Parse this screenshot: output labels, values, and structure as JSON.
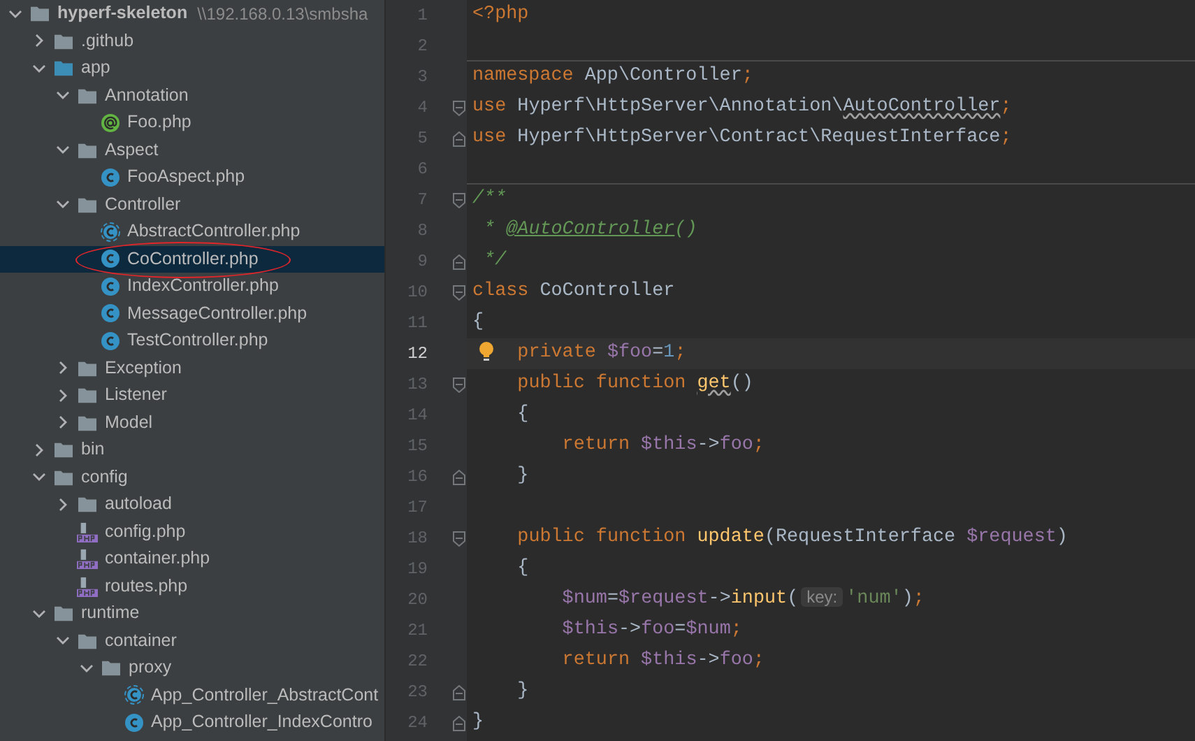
{
  "project_tree": [
    {
      "name": "hyperf-skeleton",
      "path": "\\\\192.168.0.13\\smbsha",
      "kind": "folder",
      "expanded": true,
      "selected": false,
      "children": [
        {
          "name": ".github",
          "kind": "folder",
          "expanded": false,
          "selected": false
        },
        {
          "name": "app",
          "kind": "source-folder",
          "expanded": true,
          "selected": false,
          "children": [
            {
              "name": "Annotation",
              "kind": "folder",
              "expanded": true,
              "selected": false,
              "children": [
                {
                  "name": "Foo.php",
                  "kind": "annotation",
                  "selected": false
                }
              ]
            },
            {
              "name": "Aspect",
              "kind": "folder",
              "expanded": true,
              "selected": false,
              "children": [
                {
                  "name": "FooAspect.php",
                  "kind": "class",
                  "selected": false
                }
              ]
            },
            {
              "name": "Controller",
              "kind": "folder",
              "expanded": true,
              "selected": false,
              "children": [
                {
                  "name": "AbstractController.php",
                  "kind": "abstract-class",
                  "selected": false
                },
                {
                  "name": "CoController.php",
                  "kind": "class",
                  "selected": true,
                  "circled": true
                },
                {
                  "name": "IndexController.php",
                  "kind": "class",
                  "selected": false
                },
                {
                  "name": "MessageController.php",
                  "kind": "class",
                  "selected": false
                },
                {
                  "name": "TestController.php",
                  "kind": "class",
                  "selected": false
                }
              ]
            },
            {
              "name": "Exception",
              "kind": "folder",
              "expanded": false,
              "selected": false
            },
            {
              "name": "Listener",
              "kind": "folder",
              "expanded": false,
              "selected": false
            },
            {
              "name": "Model",
              "kind": "folder",
              "expanded": false,
              "selected": false
            }
          ]
        },
        {
          "name": "bin",
          "kind": "folder",
          "expanded": false,
          "selected": false
        },
        {
          "name": "config",
          "kind": "folder",
          "expanded": true,
          "selected": false,
          "children": [
            {
              "name": "autoload",
              "kind": "folder",
              "expanded": false,
              "selected": false
            },
            {
              "name": "config.php",
              "kind": "php-file",
              "selected": false
            },
            {
              "name": "container.php",
              "kind": "php-file",
              "selected": false
            },
            {
              "name": "routes.php",
              "kind": "php-file",
              "selected": false
            }
          ]
        },
        {
          "name": "runtime",
          "kind": "folder",
          "expanded": true,
          "selected": false,
          "children": [
            {
              "name": "container",
              "kind": "folder",
              "expanded": true,
              "selected": false,
              "children": [
                {
                  "name": "proxy",
                  "kind": "folder",
                  "expanded": true,
                  "selected": false,
                  "children": [
                    {
                      "name": "App_Controller_AbstractCont",
                      "kind": "abstract-class",
                      "selected": false
                    },
                    {
                      "name": "App_Controller_IndexContro",
                      "kind": "class",
                      "selected": false
                    }
                  ]
                }
              ]
            }
          ]
        }
      ]
    }
  ],
  "editor": {
    "lines": [
      {
        "number": "1",
        "fold_start": false,
        "fold_end": false,
        "current": false,
        "tokens": [
          {
            "kind": "keyword",
            "text": "<?php"
          }
        ]
      },
      {
        "number": "2",
        "fold_start": false,
        "fold_end": false,
        "current": false,
        "separator": true
      },
      {
        "number": "3",
        "fold_start": false,
        "fold_end": false,
        "current": false,
        "tokens": [
          {
            "kind": "keyword",
            "text": "namespace "
          },
          {
            "kind": "plain",
            "text": "App\\Controller"
          },
          {
            "kind": "keyword",
            "text": ";"
          }
        ]
      },
      {
        "number": "4",
        "fold_start": true,
        "fold_end": false,
        "current": false,
        "tokens": [
          {
            "kind": "keyword",
            "text": "use "
          },
          {
            "kind": "plain",
            "text": "Hyperf\\HttpServer\\Annotation\\"
          },
          {
            "kind": "plain",
            "text": "AutoController",
            "warning": true
          },
          {
            "kind": "keyword",
            "text": ";"
          }
        ]
      },
      {
        "number": "5",
        "fold_start": false,
        "fold_end": true,
        "current": false,
        "tokens": [
          {
            "kind": "keyword",
            "text": "use "
          },
          {
            "kind": "plain",
            "text": "Hyperf\\HttpServer\\Contract\\RequestInterface"
          },
          {
            "kind": "keyword",
            "text": ";"
          }
        ]
      },
      {
        "number": "6",
        "fold_start": false,
        "fold_end": false,
        "current": false,
        "separator": true
      },
      {
        "number": "7",
        "fold_start": true,
        "fold_end": false,
        "current": false,
        "tokens": [
          {
            "kind": "comment",
            "text": "/**"
          }
        ]
      },
      {
        "number": "8",
        "fold_start": false,
        "fold_end": false,
        "current": false,
        "tokens": [
          {
            "kind": "comment",
            "text": " * "
          },
          {
            "kind": "doc-tag",
            "text": "@AutoController"
          },
          {
            "kind": "comment",
            "text": "()"
          }
        ]
      },
      {
        "number": "9",
        "fold_start": false,
        "fold_end": true,
        "current": false,
        "tokens": [
          {
            "kind": "comment",
            "text": " */"
          }
        ]
      },
      {
        "number": "10",
        "fold_start": true,
        "fold_end": false,
        "current": false,
        "tokens": [
          {
            "kind": "keyword",
            "text": "class "
          },
          {
            "kind": "plain",
            "text": "CoController"
          }
        ]
      },
      {
        "number": "11",
        "fold_start": false,
        "fold_end": false,
        "current": false,
        "tokens": [
          {
            "kind": "plain",
            "text": "{"
          }
        ]
      },
      {
        "number": "12",
        "fold_start": false,
        "fold_end": false,
        "current": true,
        "bulb": true,
        "tokens": [
          {
            "kind": "keyword",
            "text": "    private "
          },
          {
            "kind": "variable",
            "text": "$foo"
          },
          {
            "kind": "plain",
            "text": "="
          },
          {
            "kind": "number",
            "text": "1"
          },
          {
            "kind": "keyword",
            "text": ";"
          }
        ]
      },
      {
        "number": "13",
        "fold_start": true,
        "fold_end": false,
        "current": false,
        "tokens": [
          {
            "kind": "keyword",
            "text": "    public function "
          },
          {
            "kind": "function",
            "text": "get",
            "warning": true
          },
          {
            "kind": "plain",
            "text": "()"
          }
        ]
      },
      {
        "number": "14",
        "fold_start": false,
        "fold_end": false,
        "current": false,
        "tokens": [
          {
            "kind": "plain",
            "text": "    {"
          }
        ]
      },
      {
        "number": "15",
        "fold_start": false,
        "fold_end": false,
        "current": false,
        "tokens": [
          {
            "kind": "keyword",
            "text": "        return "
          },
          {
            "kind": "variable",
            "text": "$this"
          },
          {
            "kind": "plain",
            "text": "->"
          },
          {
            "kind": "variable",
            "text": "foo"
          },
          {
            "kind": "keyword",
            "text": ";"
          }
        ]
      },
      {
        "number": "16",
        "fold_start": false,
        "fold_end": true,
        "current": false,
        "tokens": [
          {
            "kind": "plain",
            "text": "    }"
          }
        ]
      },
      {
        "number": "17",
        "fold_start": false,
        "fold_end": false,
        "current": false
      },
      {
        "number": "18",
        "fold_start": true,
        "fold_end": false,
        "current": false,
        "tokens": [
          {
            "kind": "keyword",
            "text": "    public function "
          },
          {
            "kind": "function",
            "text": "update"
          },
          {
            "kind": "plain",
            "text": "(RequestInterface "
          },
          {
            "kind": "variable",
            "text": "$request"
          },
          {
            "kind": "plain",
            "text": ")"
          }
        ]
      },
      {
        "number": "19",
        "fold_start": false,
        "fold_end": false,
        "current": false,
        "tokens": [
          {
            "kind": "plain",
            "text": "    {"
          }
        ]
      },
      {
        "number": "20",
        "fold_start": false,
        "fold_end": false,
        "current": false,
        "tokens": [
          {
            "kind": "variable",
            "text": "        $num"
          },
          {
            "kind": "plain",
            "text": "="
          },
          {
            "kind": "variable",
            "text": "$request"
          },
          {
            "kind": "plain",
            "text": "->"
          },
          {
            "kind": "function",
            "text": "input"
          },
          {
            "kind": "plain",
            "text": "("
          },
          {
            "kind": "hint",
            "text": "key:"
          },
          {
            "kind": "string",
            "text": "'num'"
          },
          {
            "kind": "plain",
            "text": ")"
          },
          {
            "kind": "keyword",
            "text": ";"
          }
        ]
      },
      {
        "number": "21",
        "fold_start": false,
        "fold_end": false,
        "current": false,
        "tokens": [
          {
            "kind": "variable",
            "text": "        $this"
          },
          {
            "kind": "plain",
            "text": "->"
          },
          {
            "kind": "variable",
            "text": "foo"
          },
          {
            "kind": "plain",
            "text": "="
          },
          {
            "kind": "variable",
            "text": "$num"
          },
          {
            "kind": "keyword",
            "text": ";"
          }
        ]
      },
      {
        "number": "22",
        "fold_start": false,
        "fold_end": false,
        "current": false,
        "tokens": [
          {
            "kind": "keyword",
            "text": "        return "
          },
          {
            "kind": "variable",
            "text": "$this"
          },
          {
            "kind": "plain",
            "text": "->"
          },
          {
            "kind": "variable",
            "text": "foo"
          },
          {
            "kind": "keyword",
            "text": ";"
          }
        ]
      },
      {
        "number": "23",
        "fold_start": false,
        "fold_end": true,
        "current": false,
        "tokens": [
          {
            "kind": "plain",
            "text": "    }"
          }
        ]
      },
      {
        "number": "24",
        "fold_start": false,
        "fold_end": true,
        "current": false,
        "tokens": [
          {
            "kind": "plain",
            "text": "}"
          }
        ]
      }
    ]
  }
}
